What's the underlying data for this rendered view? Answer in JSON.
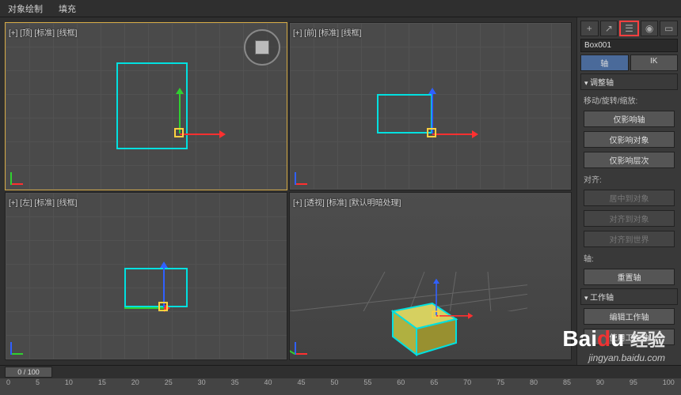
{
  "topbar": {
    "item1": "对象绘制",
    "item2": "填充"
  },
  "viewports": {
    "top": {
      "label": "[+] [顶] [标准] [线框]"
    },
    "front": {
      "label": "[+] [前] [标准] [线框]"
    },
    "left": {
      "label": "[+] [左] [标准] [线框]"
    },
    "persp": {
      "label": "[+] [透视] [标准] [默认明暗处理]"
    }
  },
  "sidebar": {
    "object_name": "Box001",
    "tab_axis": "轴",
    "tab_ik": "IK",
    "rollout_adjust": "调整轴",
    "label_move": "移动/旋转/缩放:",
    "btn_affect_pivot": "仅影响轴",
    "btn_affect_object": "仅影响对象",
    "btn_affect_hier": "仅影响层次",
    "label_align": "对齐:",
    "btn_center_obj": "居中到对象",
    "btn_align_obj": "对齐到对象",
    "btn_align_world": "对齐到世界",
    "label_pivot": "轴:",
    "btn_reset_pivot": "重置轴",
    "rollout_work": "工作轴",
    "btn_edit_work": "编辑工作轴",
    "btn_use_work": "使用工作轴"
  },
  "timeline": {
    "slider": "0 / 100",
    "ticks": [
      "0",
      "5",
      "10",
      "15",
      "20",
      "25",
      "30",
      "35",
      "40",
      "45",
      "50",
      "55",
      "60",
      "65",
      "70",
      "75",
      "80",
      "85",
      "90",
      "95",
      "100"
    ]
  },
  "watermark": {
    "logo": "Baidu 经验",
    "url": "jingyan.baidu.com"
  }
}
